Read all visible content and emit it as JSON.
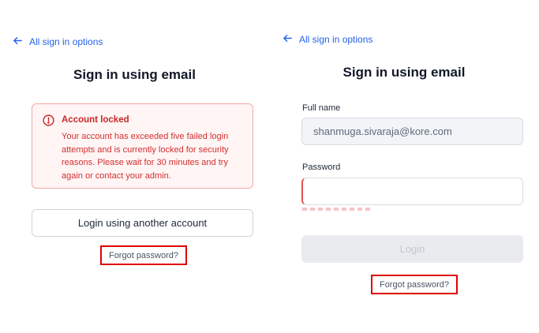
{
  "left": {
    "back_link": "All sign in options",
    "title": "Sign in using email",
    "alert": {
      "title": "Account locked",
      "message": "Your account has exceeded five failed login attempts and is currently locked for security reasons. Please wait for 30 minutes and try again or contact your admin."
    },
    "alt_login_button": "Login using another account",
    "forgot_password": "Forgot password?"
  },
  "right": {
    "back_link": "All sign in options",
    "title": "Sign in using email",
    "full_name_label": "Full name",
    "full_name_value": "shanmuga.sivaraja@kore.com",
    "password_label": "Password",
    "password_value": "",
    "login_button": "Login",
    "forgot_password": "Forgot password?"
  },
  "colors": {
    "link": "#2563eb",
    "error": "#d32f2f",
    "highlight": "#e00000"
  }
}
